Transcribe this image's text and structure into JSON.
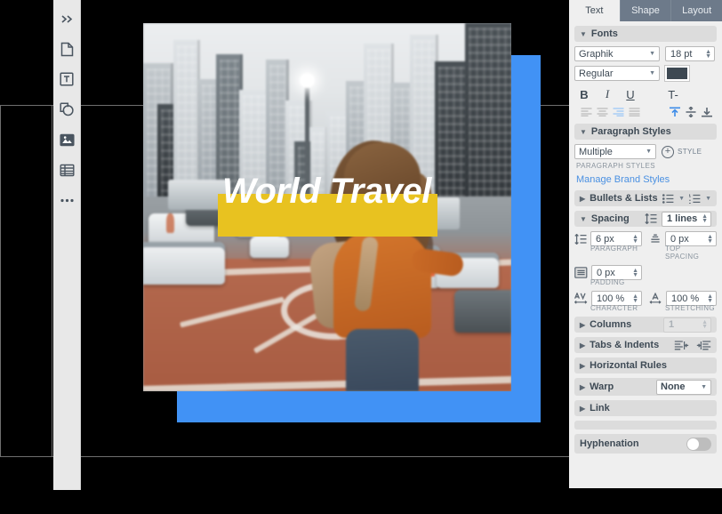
{
  "canvas": {
    "heading_text": "World Travel",
    "heading_color": "#ffffff",
    "text_block_color": "#e8c220",
    "blue_shape_color": "#4192f5"
  },
  "left_toolbar": {
    "items": [
      {
        "name": "expand-panel",
        "icon": "chevron-double-right-icon"
      },
      {
        "name": "page-tool",
        "icon": "page-icon"
      },
      {
        "name": "text-tool",
        "icon": "text-box-icon"
      },
      {
        "name": "shape-tool",
        "icon": "shapes-icon"
      },
      {
        "name": "image-tool",
        "icon": "image-icon"
      },
      {
        "name": "table-tool",
        "icon": "table-icon"
      },
      {
        "name": "more-tools",
        "icon": "ellipsis-icon"
      }
    ]
  },
  "right_panel": {
    "tabs": [
      {
        "label": "Text",
        "active": true
      },
      {
        "label": "Shape",
        "active": false
      },
      {
        "label": "Layout",
        "active": false
      }
    ],
    "fonts": {
      "title": "Fonts",
      "family": "Graphik",
      "size": "18 pt",
      "style": "Regular",
      "color": "#3d4852",
      "bold_label": "B",
      "italic_label": "I",
      "underline_label": "U",
      "more_text_label": "T-"
    },
    "paragraph_styles": {
      "title": "Paragraph Styles",
      "value": "Multiple",
      "style_button_label": "STYLE",
      "caption": "PARAGRAPH STYLES",
      "manage_link": "Manage Brand Styles"
    },
    "bullets_lists": {
      "title": "Bullets & Lists"
    },
    "spacing": {
      "title": "Spacing",
      "line_value": "1 lines",
      "paragraph_value": "6 px",
      "paragraph_caption": "PARAGRAPH",
      "top_spacing_value": "0 px",
      "top_spacing_caption": "TOP SPACING",
      "padding_value": "0 px",
      "padding_caption": "PADDING",
      "character_value": "100 %",
      "character_caption": "CHARACTER",
      "stretching_value": "100 %",
      "stretching_caption": "STRETCHING"
    },
    "columns": {
      "title": "Columns",
      "value": "1"
    },
    "tabs_indents": {
      "title": "Tabs & Indents"
    },
    "horizontal_rules": {
      "title": "Horizontal Rules"
    },
    "warp": {
      "title": "Warp",
      "value": "None"
    },
    "link": {
      "title": "Link"
    },
    "hyphenation": {
      "title": "Hyphenation",
      "enabled": false
    }
  }
}
